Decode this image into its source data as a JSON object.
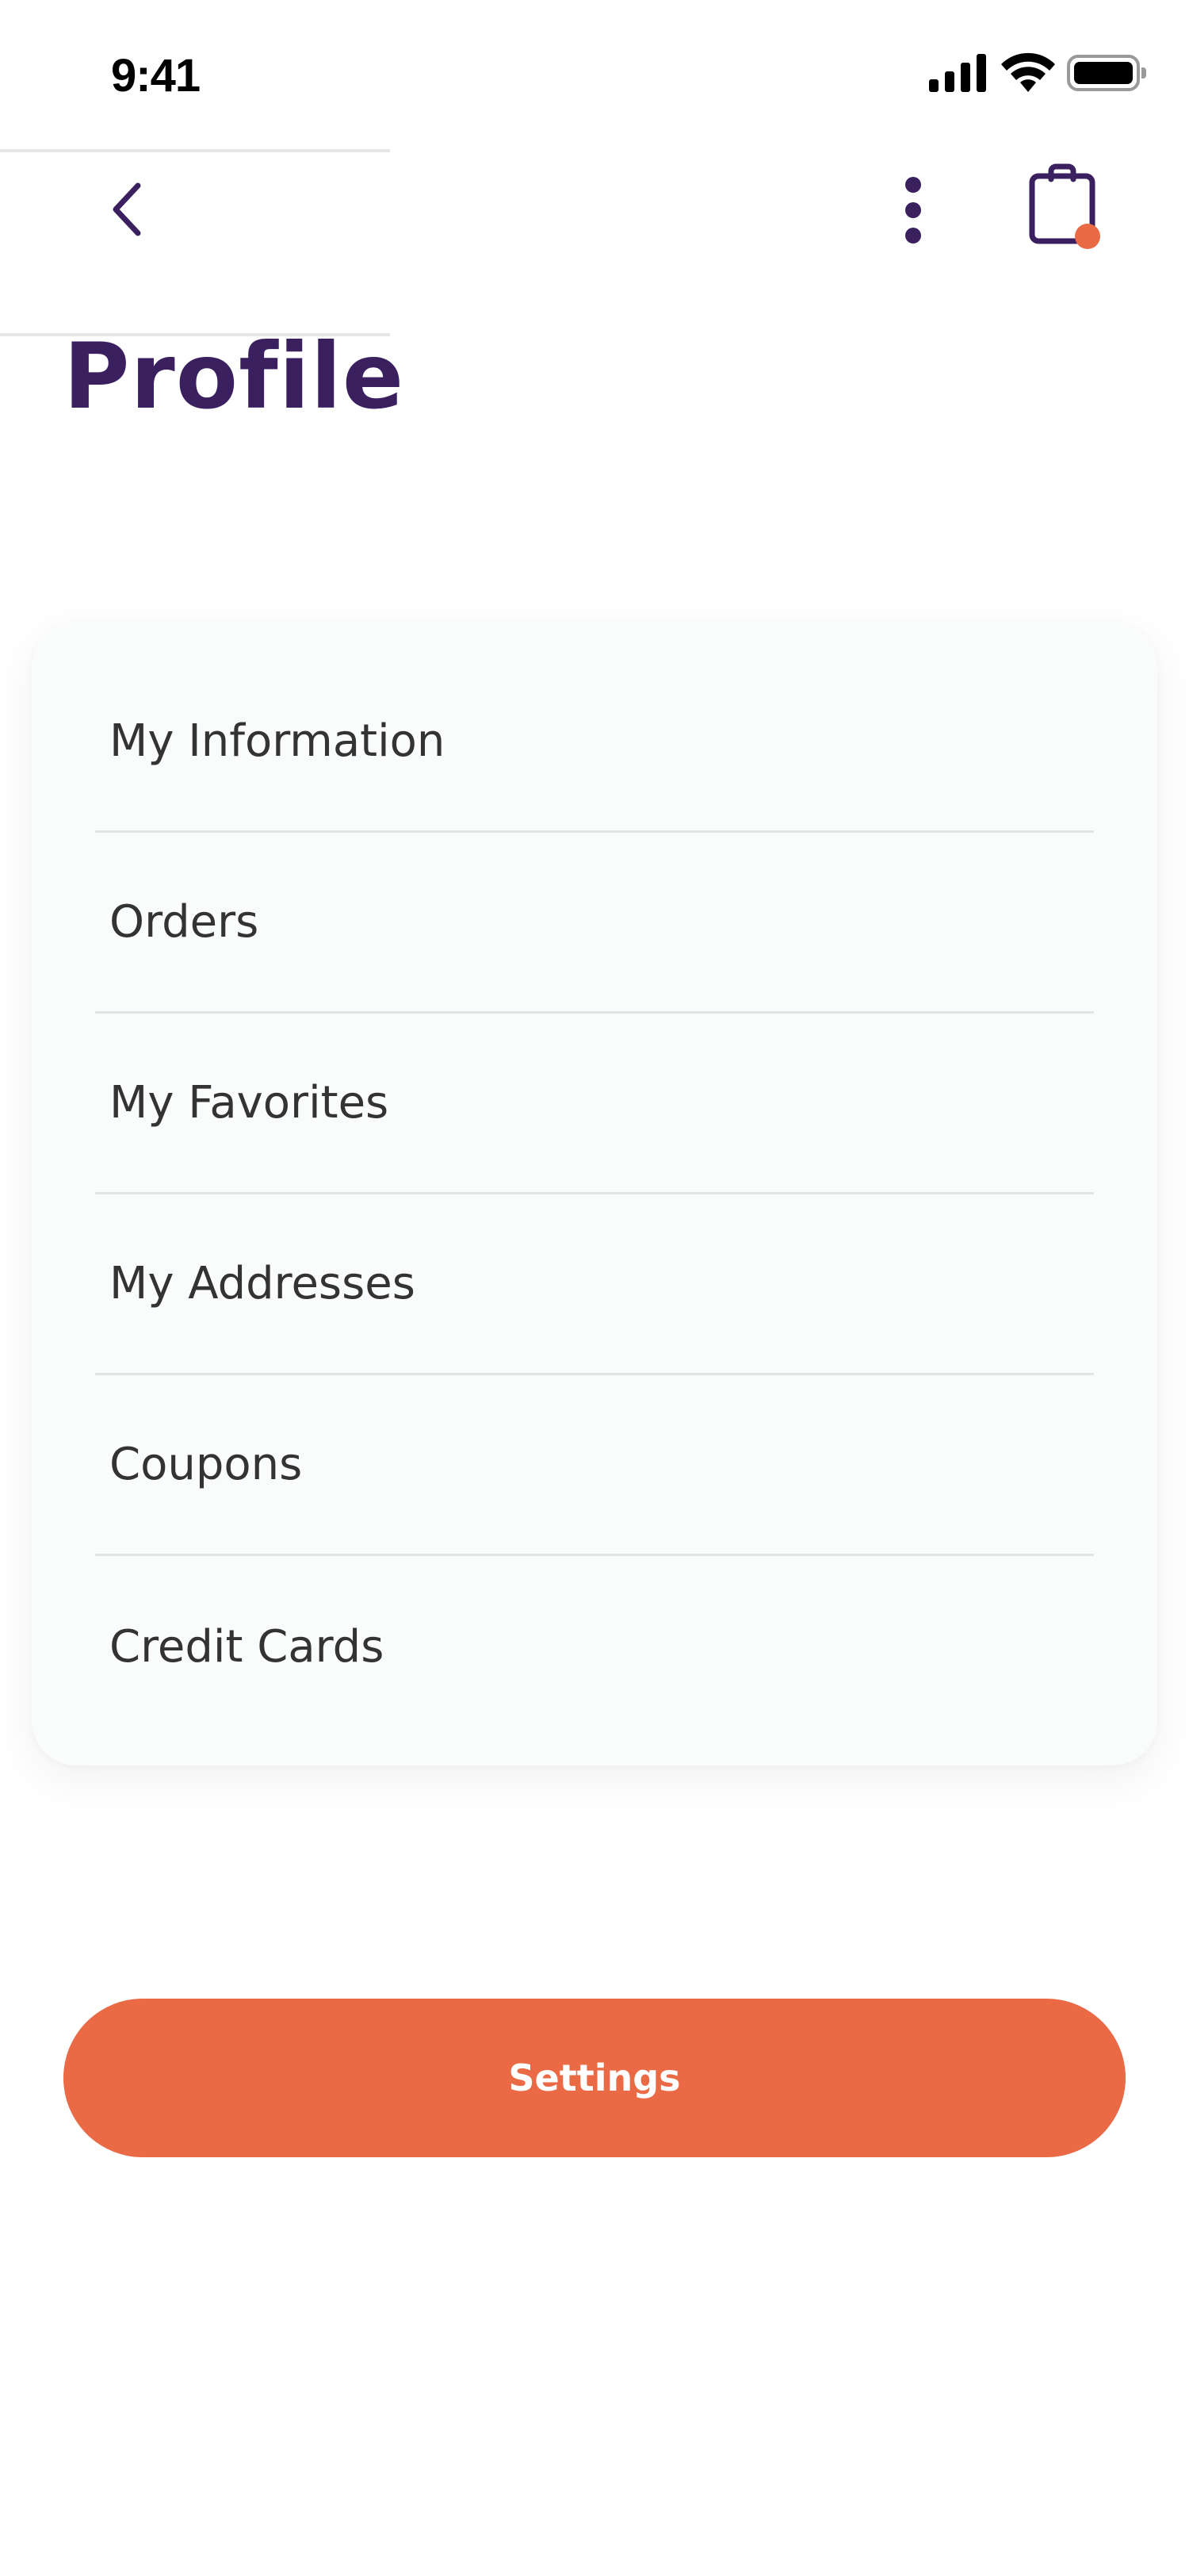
{
  "status_bar": {
    "time": "9:41",
    "icons": [
      "signal-icon",
      "wifi-icon",
      "battery-icon"
    ]
  },
  "nav": {
    "back_icon": "chevron-left-icon",
    "more_icon": "more-vertical-icon",
    "cart_icon": "shopping-bag-icon",
    "cart_has_notification": true
  },
  "page": {
    "title": "Profile"
  },
  "menu": {
    "items": [
      {
        "label": "My Information"
      },
      {
        "label": "Orders"
      },
      {
        "label": "My Favorites"
      },
      {
        "label": "My Addresses"
      },
      {
        "label": "Coupons"
      },
      {
        "label": "Credit Cards"
      }
    ]
  },
  "actions": {
    "settings_label": "Settings"
  },
  "colors": {
    "primary": "#3b2060",
    "accent": "#e96a45",
    "card_background": "#fafbfb",
    "text": "#333333",
    "divider": "#e3e5e5"
  }
}
